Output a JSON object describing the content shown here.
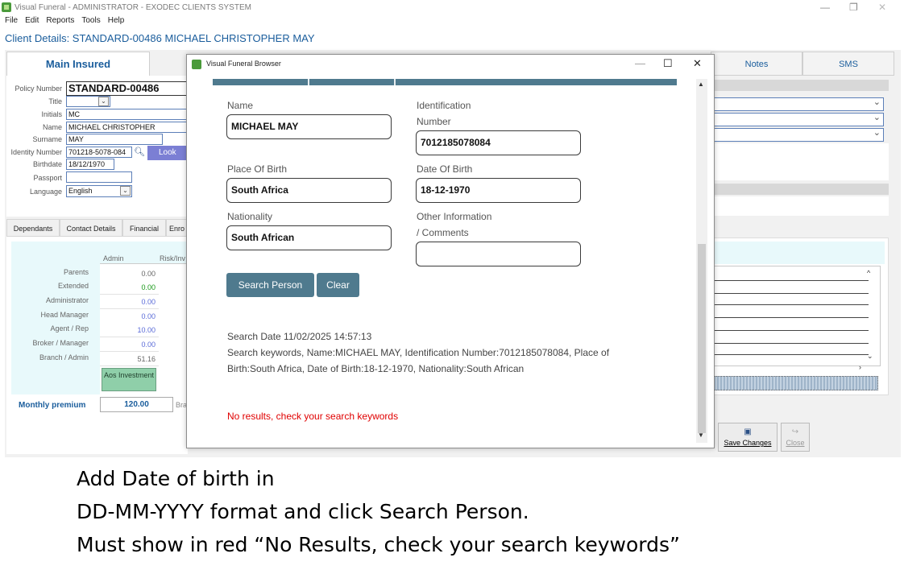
{
  "window": {
    "title": "Visual Funeral - ADMINISTRATOR - EXODEC CLIENTS SYSTEM",
    "menu": [
      "File",
      "Edit",
      "Reports",
      "Tools",
      "Help"
    ],
    "client_details": "Client Details: STANDARD-00486 MICHAEL CHRISTOPHER MAY"
  },
  "tabs": {
    "main_insured": "Main Insured",
    "notes": "Notes",
    "sms": "SMS"
  },
  "left_form": {
    "policy_number_label": "Policy Number",
    "policy_number": "STANDARD-00486",
    "title_label": "Title",
    "initials_label": "Initials",
    "initials": "MC",
    "name_label": "Name",
    "name": "MICHAEL CHRISTOPHER",
    "surname_label": "Surname",
    "surname": "MAY",
    "identity_label": "Identity Number",
    "identity": "701218-5078-084",
    "lookup": "Look",
    "birthdate_label": "Birthdate",
    "birthdate": "18/12/1970",
    "passport_label": "Passport",
    "language_label": "Language",
    "language": "English"
  },
  "lower_tabs": [
    "Dependants",
    "Contact Details",
    "Financial",
    "Enro"
  ],
  "premium_table": {
    "col_admin": "Admin",
    "col_risk": "Risk/Inv",
    "rows": [
      {
        "label": "Parents",
        "value": "0.00"
      },
      {
        "label": "Extended",
        "value": "0.00"
      },
      {
        "label": "Administrator",
        "value": "0.00"
      },
      {
        "label": "Head Manager",
        "value": "0.00"
      },
      {
        "label": "Agent / Rep",
        "value": "10.00"
      },
      {
        "label": "Broker / Manager",
        "value": "0.00"
      },
      {
        "label": "Branch / Admin",
        "value": "51.16"
      }
    ],
    "aos_button": "Aos Investment",
    "monthly_premium_label": "Monthly premium",
    "monthly_premium": "120.00",
    "bra": "Bra"
  },
  "buttons": {
    "save_changes": "Save Changes",
    "close": "Close"
  },
  "modal": {
    "title": "Visual Funeral Browser",
    "name_label": "Name",
    "name_value": "MICHAEL MAY",
    "id_label_1": "Identification",
    "id_label_2": "Number",
    "id_value": "7012185078084",
    "pob_label": "Place Of Birth",
    "pob_value": "South Africa",
    "dob_label": "Date Of Birth",
    "dob_value": "18-12-1970",
    "nationality_label": "Nationality",
    "nationality_value": "South African",
    "other_label_1": "Other Information",
    "other_label_2": "/ Comments",
    "other_value": "",
    "search_button": "Search Person",
    "clear_button": "Clear",
    "search_date": "Search Date 11/02/2025 14:57:13",
    "search_keywords_1": "Search keywords, Name:MICHAEL MAY, Identification Number:7012185078084, Place of",
    "search_keywords_2": "Birth:South Africa, Date of Birth:18-12-1970, Nationality:South African",
    "no_results": "No results, check your search keywords"
  },
  "caption": {
    "line1": "Add Date of birth in",
    "line2": "DD-MM-YYYY format and click Search Person.",
    "line3": "Must show in red “No Results, check your search keywords”"
  },
  "colors": {
    "accent": "#4f7a8e",
    "link_blue": "#1a5d9c",
    "error_red": "#e00000"
  }
}
